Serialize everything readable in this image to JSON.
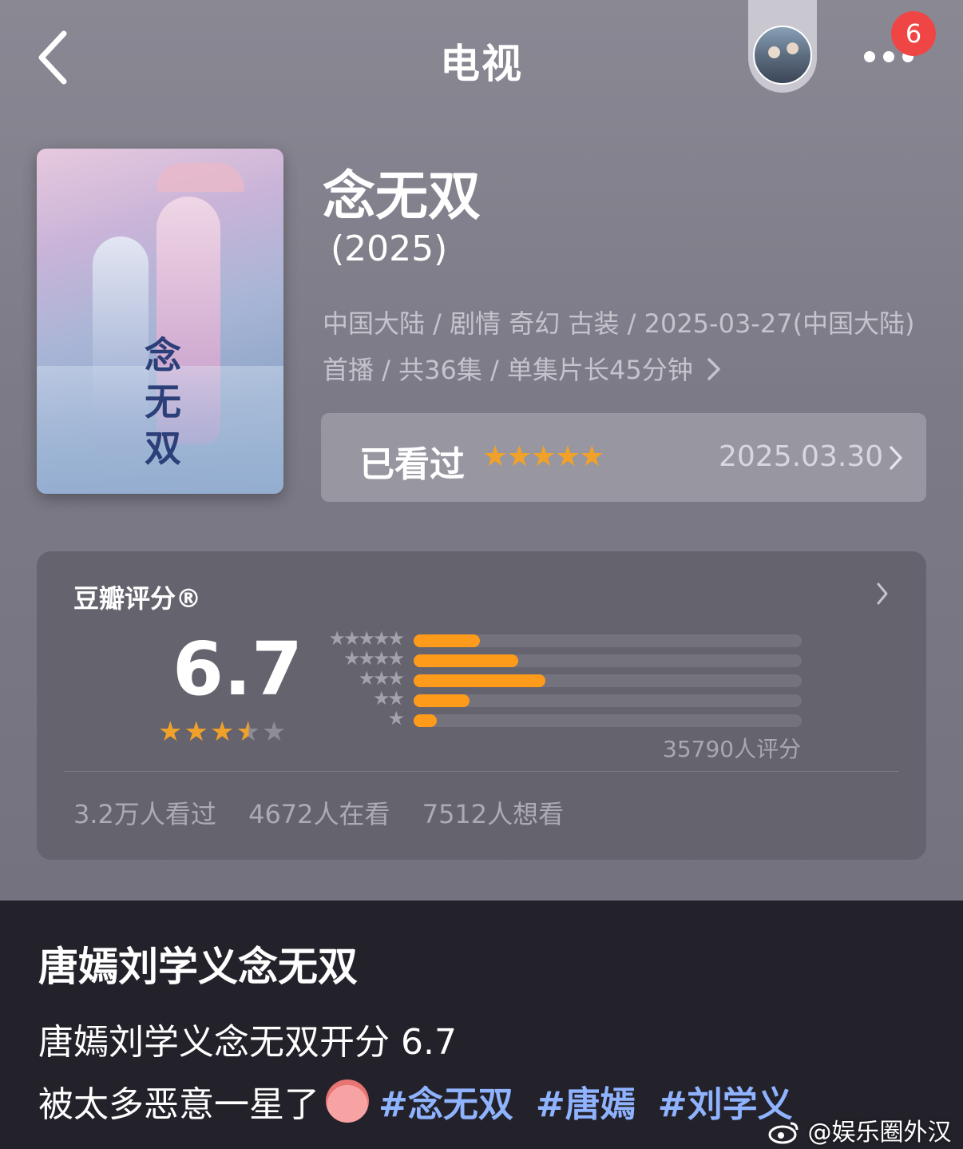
{
  "header": {
    "title": "电视",
    "badge_count": "6",
    "icons": {
      "back": "chevron-left-icon",
      "more": "ellipsis-icon"
    }
  },
  "show": {
    "title": "念无双",
    "year": "(2025)",
    "meta": "中国大陆 / 剧情 奇幻 古装 / 2025-03-27(中国大陆) 首播 / 共36集 / 单集片长45分钟",
    "poster_title": "念无双"
  },
  "watch_status": {
    "label": "已看过",
    "stars": "★★★★★",
    "date": "2025.03.30"
  },
  "rating": {
    "header": "豆瓣评分®",
    "score": "6.7",
    "score_stars_rating": 3.5,
    "count_label": "35790人评分",
    "distribution": [
      {
        "stars": "★★★★★",
        "fraction": 0.17
      },
      {
        "stars": "★★★★",
        "fraction": 0.27
      },
      {
        "stars": "★★★",
        "fraction": 0.34
      },
      {
        "stars": "★★",
        "fraction": 0.145
      },
      {
        "stars": "★",
        "fraction": 0.06
      }
    ],
    "stats": {
      "watched": "3.2万人看过",
      "watching": "4672人在看",
      "wish": "7512人想看"
    }
  },
  "post": {
    "title": "唐嫣刘学义念无双",
    "line1": "唐嫣刘学义念无双开分 6.7",
    "line2_text": "被太多恶意一星了",
    "hashtags": [
      "#念无双",
      "#唐嫣",
      "#刘学义"
    ]
  },
  "watermark": "@娱乐圈外汉",
  "colors": {
    "accent_orange": "#ff9b1a",
    "star_orange": "#f0a12a",
    "hashtag_blue": "#8fb3ff",
    "badge_red": "#f04545"
  }
}
